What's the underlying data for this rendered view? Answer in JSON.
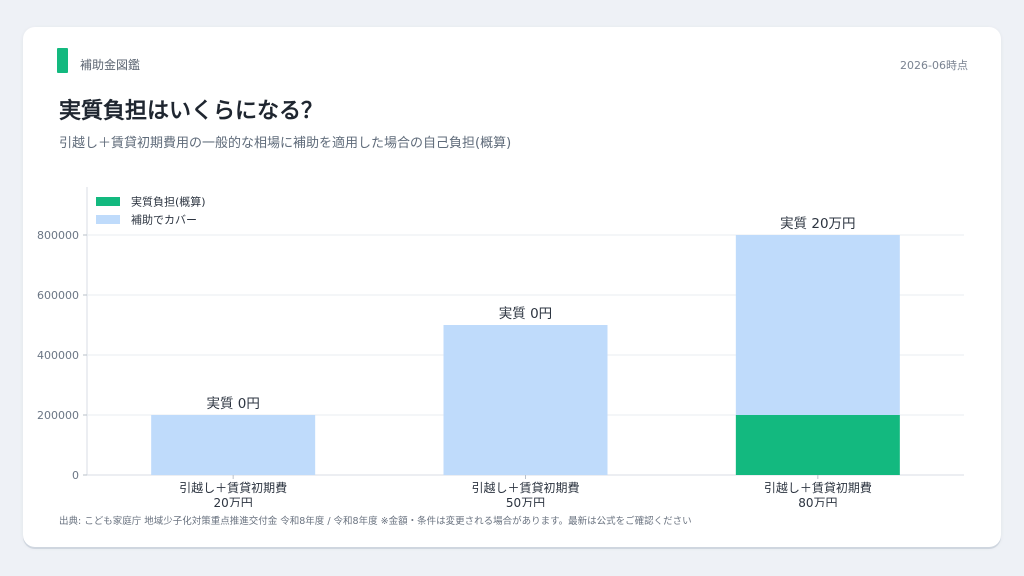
{
  "header": {
    "brand": "補助金図鑑",
    "date": "2026-06時点",
    "title": "実質負担はいくらになる？",
    "subtitle": "引越し＋賃貸初期費用の一般的な相場に補助を適用した場合の自己負担(概算)"
  },
  "footer": {
    "source": "出典: こども家庭庁 地域少子化対策重点推進交付金 令和8年度 / 令和8年度 ※金額・条件は変更される場合があります。最新は公式をご確認ください"
  },
  "colors": {
    "self_burden": "#13b97f",
    "subsidy": "#bfdbfb",
    "grid": "#e9edf2",
    "axis_text": "#6b7685"
  },
  "chart_data": {
    "type": "bar",
    "stacked": true,
    "categories": [
      [
        "引越し＋賃貸初期費",
        "20万円"
      ],
      [
        "引越し＋賃貸初期費",
        "50万円"
      ],
      [
        "引越し＋賃貸初期費",
        "80万円"
      ]
    ],
    "series": [
      {
        "name": "実質負担(概算)",
        "color": "#13b97f",
        "values": [
          0,
          0,
          200000
        ]
      },
      {
        "name": "補助でカバー",
        "color": "#bfdbfb",
        "values": [
          200000,
          500000,
          600000
        ]
      }
    ],
    "data_labels": [
      "実質 0円",
      "実質 0円",
      "実質 20万円"
    ],
    "ylim": [
      0,
      960000
    ],
    "yticks": [
      0,
      200000,
      400000,
      600000,
      800000
    ],
    "grid": true,
    "legend": "top-left"
  }
}
